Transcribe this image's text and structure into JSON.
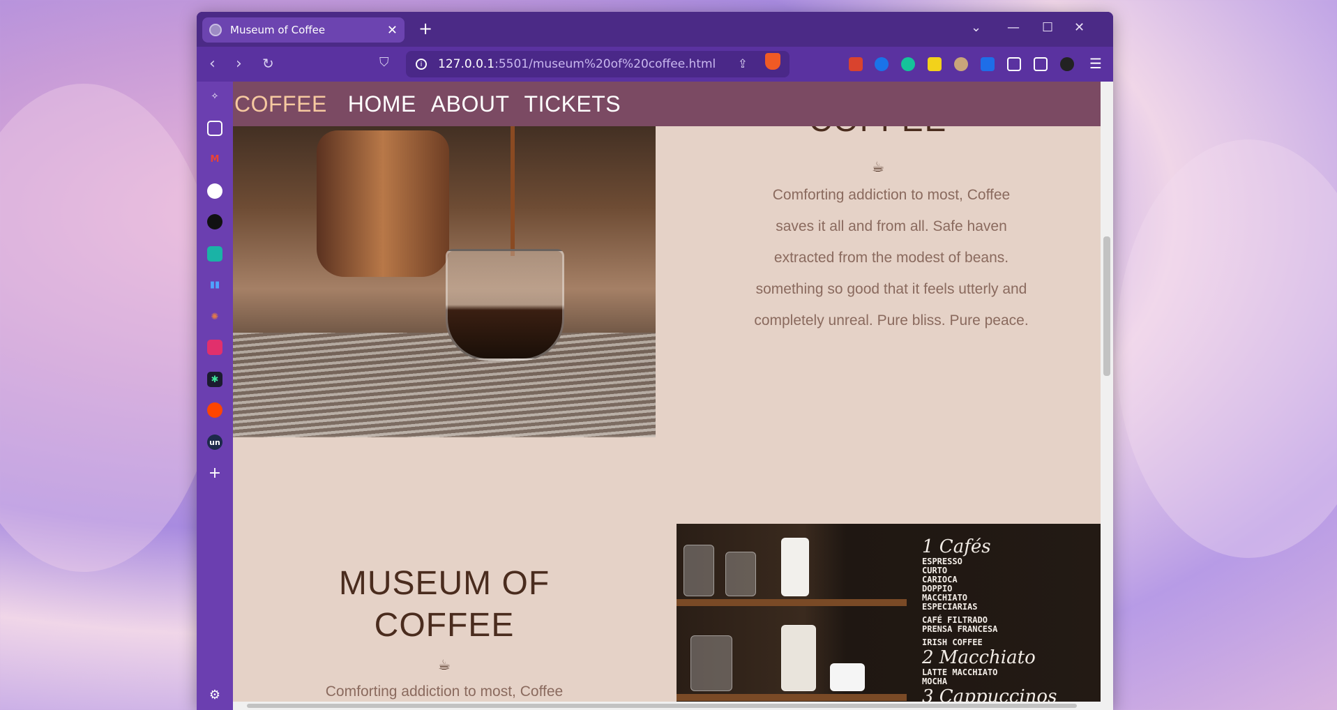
{
  "browser": {
    "tab_title": "Museum of Coffee",
    "url_host": "127.0.0.1",
    "url_path": ":5501/museum%20of%20coffee.html",
    "accent_color": "#5a32a0"
  },
  "site": {
    "nav": {
      "brand": "COFFEE",
      "items": [
        "HOME",
        "ABOUT",
        "TICKETS"
      ]
    },
    "section1": {
      "title_partial": "COFFEE",
      "icon": "coffee-cup-icon",
      "paragraph": "Comforting addiction to most, Coffee saves it all and from all. Safe haven extracted from the modest of beans. something so good that it feels utterly and completely unreal. Pure bliss. Pure peace."
    },
    "section2": {
      "title_line1": "MUSEUM OF",
      "title_line2": "COFFEE",
      "icon": "coffee-cup-icon",
      "paragraph": "Comforting addiction to most, Coffee"
    },
    "chalkboard": {
      "heading": "1 Cafés",
      "items": [
        "ESPRESSO",
        "CURTO",
        "CARIOCA",
        "DOPPIO",
        "MACCHIATO",
        "ESPECIARIAS",
        "CAFÉ FILTRADO",
        "PRENSA FRANCESA",
        "IRISH COFFEE"
      ],
      "heading2": "2 Macchiato",
      "items2": [
        "LATTE MACCHIATO",
        "MOCHA"
      ],
      "heading3": "3 Cappuccinos"
    }
  }
}
